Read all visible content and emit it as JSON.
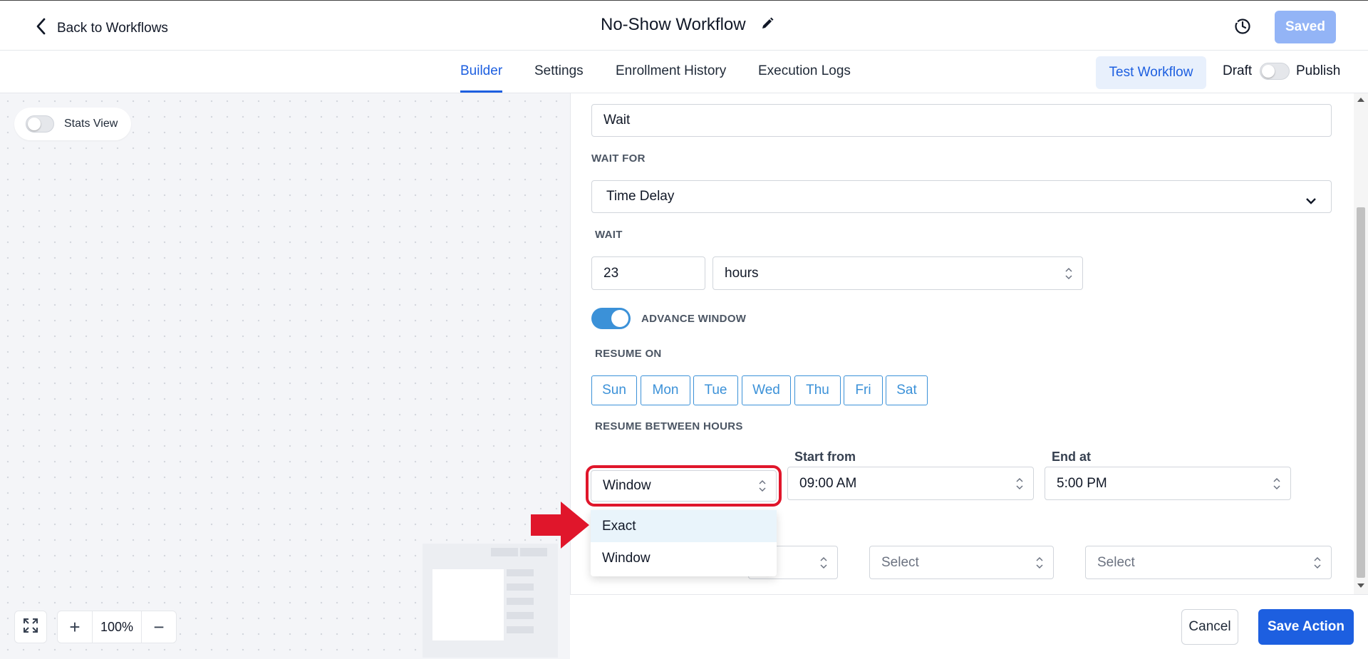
{
  "header": {
    "back_label": "Back to Workflows",
    "title": "No-Show Workflow",
    "saved_label": "Saved"
  },
  "tabs": [
    {
      "label": "Builder",
      "active": true
    },
    {
      "label": "Settings",
      "active": false
    },
    {
      "label": "Enrollment History",
      "active": false
    },
    {
      "label": "Execution Logs",
      "active": false
    }
  ],
  "tabs_right": {
    "test_label": "Test Workflow",
    "draft_label": "Draft",
    "publish_label": "Publish",
    "published": false
  },
  "canvas": {
    "stats_label": "Stats View",
    "stats_on": false,
    "zoom_level": "100%",
    "zoom_in": "+",
    "zoom_out": "−"
  },
  "form": {
    "action_name": "Wait",
    "wait_for_label": "WAIT FOR",
    "wait_for_value": "Time Delay",
    "wait_label": "WAIT",
    "wait_amount": "23",
    "wait_unit": "hours",
    "advance_window_label": "ADVANCE WINDOW",
    "advance_window_on": true,
    "resume_on_label": "RESUME ON",
    "days": [
      "Sun",
      "Mon",
      "Tue",
      "Wed",
      "Thu",
      "Fri",
      "Sat"
    ],
    "resume_between_label": "RESUME BETWEEN HOURS",
    "window_mode_value": "Window",
    "start_label": "Start from",
    "start_value": "09:00 AM",
    "end_label": "End at",
    "end_value": "5:00 PM",
    "select_placeholder_1": "Select",
    "select_placeholder_2": "Select"
  },
  "dropdown": {
    "options": [
      "Exact",
      "Window"
    ],
    "hovered": "Exact"
  },
  "footer": {
    "cancel_label": "Cancel",
    "save_label": "Save Action"
  },
  "colors": {
    "primary": "#1d5fe0",
    "accent_blue": "#3b91d8",
    "highlight_red": "#e0162b",
    "saved_disabled": "#93b4f6"
  }
}
